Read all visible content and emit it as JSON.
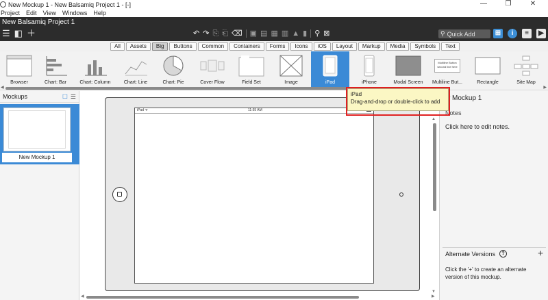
{
  "window": {
    "title": "New Mockup 1 - New Balsamiq Project 1 - [-]",
    "controls": [
      "—",
      "❐",
      "✕"
    ]
  },
  "menubar": [
    "Project",
    "Edit",
    "View",
    "Windows",
    "Help"
  ],
  "appbar": {
    "project_name": "New Balsamiq Project 1",
    "quick_add_placeholder": "Quick Add"
  },
  "filters": [
    "All",
    "Assets",
    "Big",
    "Buttons",
    "Common",
    "Containers",
    "Forms",
    "Icons",
    "iOS",
    "Layout",
    "Markup",
    "Media",
    "Symbols",
    "Text"
  ],
  "active_filter": "Big",
  "components": [
    {
      "label": "Browser",
      "icon": "browser-icon"
    },
    {
      "label": "Chart: Bar",
      "icon": "chart-bar-icon"
    },
    {
      "label": "Chart: Column",
      "icon": "chart-column-icon"
    },
    {
      "label": "Chart: Line",
      "icon": "chart-line-icon"
    },
    {
      "label": "Chart: Pie",
      "icon": "chart-pie-icon"
    },
    {
      "label": "Cover Flow",
      "icon": "cover-flow-icon"
    },
    {
      "label": "Field Set",
      "icon": "field-set-icon"
    },
    {
      "label": "Image",
      "icon": "image-icon"
    },
    {
      "label": "iPad",
      "icon": "ipad-icon",
      "selected": true
    },
    {
      "label": "iPhone",
      "icon": "iphone-icon"
    },
    {
      "label": "Modal Screen",
      "icon": "modal-screen-icon"
    },
    {
      "label": "Multiline But...",
      "icon": "multiline-button-icon",
      "thumb_text": "Multiline Button second line here"
    },
    {
      "label": "Rectangle",
      "icon": "rectangle-icon"
    },
    {
      "label": "Site Map",
      "icon": "site-map-icon"
    }
  ],
  "mockups_panel": {
    "title": "Mockups",
    "items": [
      {
        "label": "New Mockup 1"
      }
    ]
  },
  "ipad": {
    "carrier": "iPad ᯤ",
    "time": "11:55 AM"
  },
  "right_panel": {
    "title": "w Mockup 1",
    "notes_label": "Notes",
    "notes_text": "Click here to edit notes.",
    "alt_versions_label": "Alternate Versions",
    "alt_help": "?",
    "alt_add": "+",
    "alt_text": "Click the '+' to create an alternate version of this mockup."
  },
  "tooltip": {
    "title": "iPad",
    "hint": "Drag-and-drop or double-click to add"
  },
  "colors": {
    "appbar": "#2c2c2c",
    "accent": "#3b8ad6",
    "tooltip_bg": "#fbf7c4",
    "highlight": "#e02020"
  }
}
